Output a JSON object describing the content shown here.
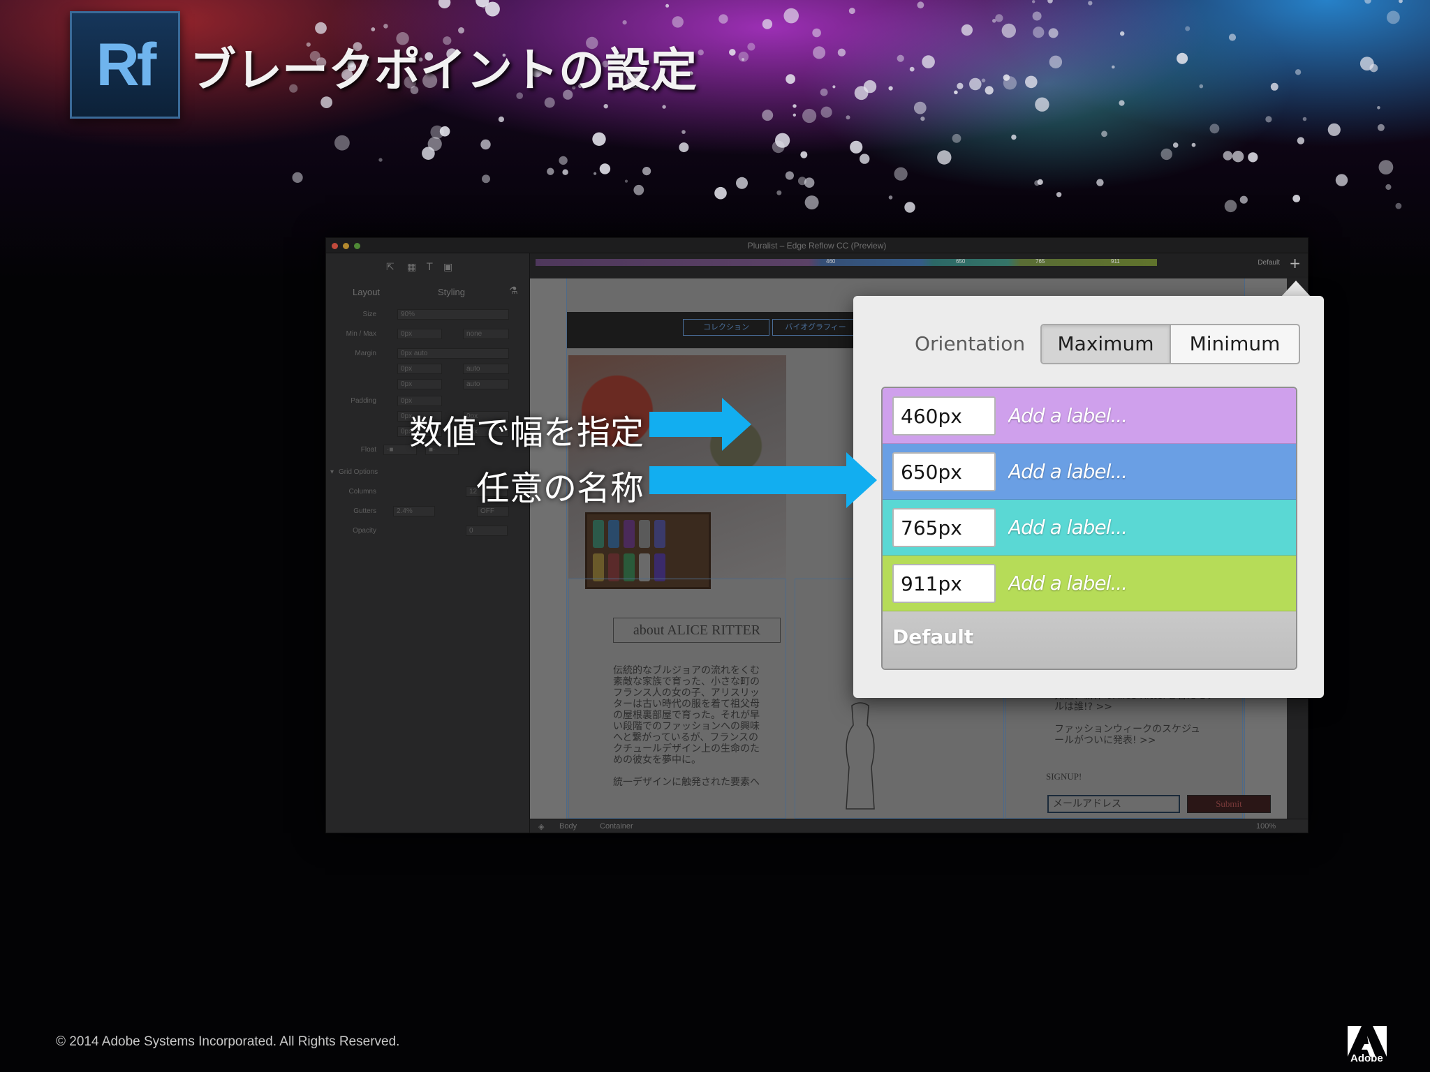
{
  "slide": {
    "title": "ブレークポイントの設定",
    "logo_text": "Rf",
    "copyright": "© 2014 Adobe Systems Incorporated. All Rights Reserved.",
    "brand": "Adobe"
  },
  "app": {
    "window_title": "Pluralist – Edge Reflow CC (Preview)",
    "panel_tabs": [
      "Layout",
      "Styling"
    ],
    "properties": {
      "size_label": "Size",
      "size_value": "90%",
      "minmax_label": "Min / Max",
      "min_value": "0px",
      "max_value": "none",
      "margin_label": "Margin",
      "margin_value": "0px auto",
      "margin_top": "0px",
      "margin_right": "auto",
      "margin_bottom": "0px",
      "margin_left": "auto",
      "padding_label": "Padding",
      "padding_value": "0px",
      "padding_a": "0px",
      "padding_b": "0px",
      "padding_c": "0px",
      "padding_d": "0px",
      "float_label": "Float",
      "grid_options_label": "Grid Options",
      "columns_label": "Columns",
      "columns_value": "12",
      "gutters_label": "Gutters",
      "gutters_value": "2.4%",
      "gutters_toggle": "OFF",
      "opacity_label": "Opacity",
      "opacity_value": "0"
    },
    "timeline": {
      "marks": [
        "460",
        "650",
        "765",
        "911"
      ],
      "default_label": "Default",
      "add_icon": "plus-icon"
    },
    "canvas": {
      "nav_items": [
        "コレクション",
        "バイオグラフィー"
      ],
      "about_heading": "about ALICE RITTER",
      "about_text": "伝統的なブルジョアの流れをくむ\n素敵な家族で育った、小さな町の\nフランス人の女の子、アリスリッ\nターは古い時代の服を着て祖父母\nの屋根裏部屋で育った。それが早\nい段階でのファッションへの興味\nへと繋がっているが、フランスの\nクチュールデザイン上の生命のた\nめの彼女を夢中に。\n\n統一デザインに触発された要素へ",
      "news_text": "先週、新作のAlice Ritterを着たモデ\nルは誰!?   >>\n\nファッションウィークのスケジュ\nールがついに発表!   >>",
      "signup_label": "SIGNUP!",
      "email_placeholder": "メールアドレス",
      "submit_label": "Submit"
    },
    "statusbar": {
      "breadcrumb_body": "Body",
      "breadcrumb_container": "Container",
      "zoom": "100%"
    }
  },
  "popover": {
    "orientation_label": "Orientation",
    "orientation_options": [
      "Maximum",
      "Minimum"
    ],
    "orientation_selected": "Maximum",
    "breakpoints": [
      {
        "value": "460px",
        "label_placeholder": "Add a label...",
        "color": "#cfa0ec"
      },
      {
        "value": "650px",
        "label_placeholder": "Add a label...",
        "color": "#6a9fe4"
      },
      {
        "value": "765px",
        "label_placeholder": "Add a label...",
        "color": "#5ad8d4"
      },
      {
        "value": "911px",
        "label_placeholder": "Add a label...",
        "color": "#b6dc58"
      }
    ],
    "default_label": "Default"
  },
  "annotations": {
    "width_by_value": "数値で幅を指定",
    "custom_name": "任意の名称",
    "arrow_color": "#12aef0"
  }
}
